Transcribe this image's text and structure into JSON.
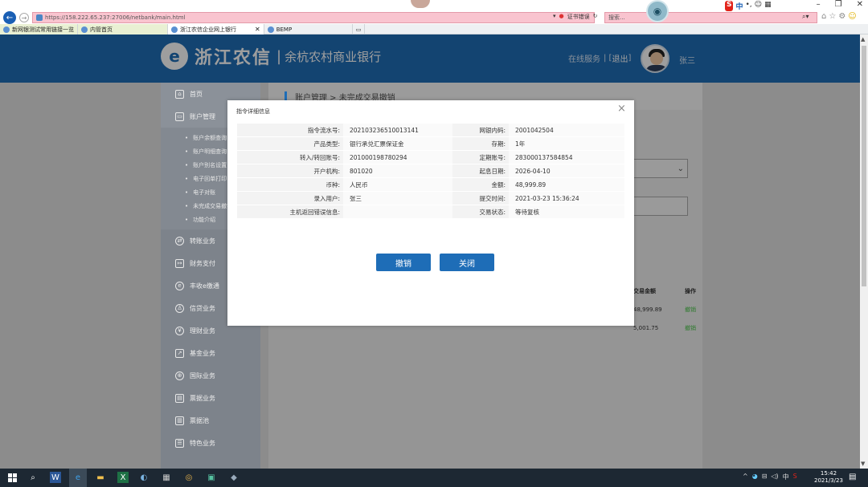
{
  "browser": {
    "url": "https://158.222.65.237:27006/netbank/main.html",
    "url_host": "158.222.65.237",
    "cert_label": "证书错误",
    "search_placeholder": "搜索...",
    "tabs": [
      {
        "label": "新网银测试常用链接一览",
        "kind": "fav"
      },
      {
        "label": "内管首页",
        "kind": "fav"
      },
      {
        "label": "浙江农信企业网上银行",
        "kind": "active"
      },
      {
        "label": "BEMP",
        "kind": "normal"
      },
      {
        "label": "",
        "kind": "new"
      }
    ],
    "ime": {
      "s": "S",
      "lang": "中"
    }
  },
  "header": {
    "logo_name": "浙江农信",
    "logo_separator": "|",
    "bank_name": "余杭农村商业银行",
    "online_service": "在线服务",
    "logout_open": "| [",
    "logout": "退出",
    "logout_close": "]",
    "username": "张三"
  },
  "sidebar": {
    "home": "首页",
    "account_mgmt": "账户管理",
    "sub_items": [
      "账户余额查询",
      "账户明细查询",
      "账户别名设置",
      "电子回单打印",
      "电子对账",
      "未完成交易撤销",
      "功能介绍"
    ],
    "items": [
      {
        "label": "转账业务",
        "icon": "transfer-icon"
      },
      {
        "label": "财务支付",
        "icon": "payment-icon"
      },
      {
        "label": "丰收e缴通",
        "icon": "e-pay-icon"
      },
      {
        "label": "信贷业务",
        "icon": "credit-icon"
      },
      {
        "label": "理财业务",
        "icon": "finance-icon"
      },
      {
        "label": "基金业务",
        "icon": "fund-icon"
      },
      {
        "label": "国际业务",
        "icon": "globe-icon"
      },
      {
        "label": "票据业务",
        "icon": "bill-icon"
      },
      {
        "label": "票据池",
        "icon": "bill-pool-icon"
      },
      {
        "label": "特色业务",
        "icon": "special-icon"
      }
    ]
  },
  "content": {
    "breadcrumb": "账户管理 > 未完成交易撤销",
    "table_header_amount": "交易金额",
    "table_header_action": "操作",
    "rows": [
      {
        "amount": "48,999.89",
        "action": "撤销"
      },
      {
        "amount": "5,001.75",
        "action": "撤销"
      }
    ]
  },
  "modal": {
    "title": "指令详细信息",
    "close_glyph": "×",
    "rows": [
      [
        {
          "label": "指令流水号:",
          "value": "20210323651001314​1"
        },
        {
          "label": "网银内码:",
          "value": "2001042504"
        }
      ],
      [
        {
          "label": "产品类型:",
          "value": "银行承兑汇票保证金"
        },
        {
          "label": "存期:",
          "value": "1年"
        }
      ],
      [
        {
          "label": "转入/转回账号:",
          "value": "201000198780294"
        },
        {
          "label": "定期账号:",
          "value": "283000137584854"
        }
      ],
      [
        {
          "label": "开户机构:",
          "value": "801020"
        },
        {
          "label": "起息日期:",
          "value": "2026-04-10"
        }
      ],
      [
        {
          "label": "币种:",
          "value": "人民币"
        },
        {
          "label": "金额:",
          "value": "48,999.89"
        }
      ],
      [
        {
          "label": "录入用户:",
          "value": "张三"
        },
        {
          "label": "提交时间:",
          "value": "2021-03-23 15:36:24"
        }
      ],
      [
        {
          "label": "主机返回错误信息:",
          "value": ""
        },
        {
          "label": "交易状态:",
          "value": "等待复核"
        }
      ]
    ],
    "cancel_label": "撤销",
    "close_label": "关闭"
  },
  "taskbar": {
    "time": "15:42",
    "date": "2021/3/23",
    "tray_text": "中"
  },
  "colors": {
    "brand_blue": "#1e6db7",
    "overlay_gray": "#8c8c8c",
    "url_pink": "#f9c4cf"
  }
}
